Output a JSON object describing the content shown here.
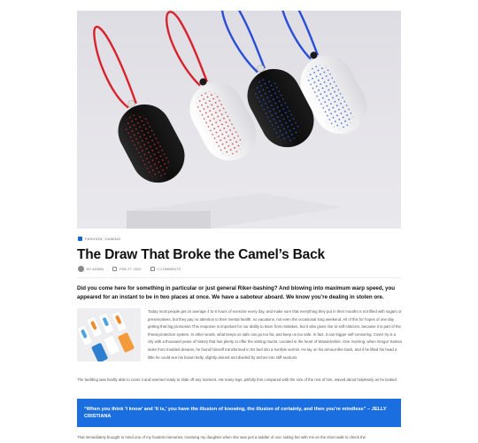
{
  "post": {
    "categories": "FASHION, GAMING",
    "title": "The Draw That Broke the Camel’s Back",
    "author": "BY ADMIN",
    "date": "FEB 27, 2020",
    "comments": "0 COMMENTS",
    "lead": "Did you come here for something in particular or just general Riker-bashing? And blowing into maximum warp speed, you appeared for an instant to be in two places at once. We have a saboteur aboard. We know you’re dealing in stolen ore.",
    "paragraph_1": "Today most people get on average 4 to 6 hours of exercise every day, and make sure that everything they put in their mouths is not filled with sugars or preservatives, but they pay no attention to their mental health, no vacations, not even the occasional long weekend. All of this for hopes of one day getting that big promotion.This response is important for our ability to learn from mistakes, but it also gives rise to self-criticism, because it is part of the threat-protection system. In other words, what keeps us safe can go too far, and keep us too safe. In fact, it can trigger self-censoring. Cover try is a city with a thousand years of history that has plenty to offer the visiting tourist. Located in the heart of Warwickshire. One morning, when Gregor Samsa woke from troubled dreams, he found himself transformed in his bed into a horrible vermin. He lay on his armour-like back, and if he lifted his head a little he could see his brown belly, slightly domed and divided by arches into stiff sections.",
    "paragraph_2": "The bedding was hardly able to cover it and seemed ready to slide off any moment. His many legs, pitifully thin compared with the size of the rest of him, waved about helplessly as he looked.",
    "quote": "“When you think ‘I know’ and ‘It is,’ you have the illusion of knowing, the illusion of certainty, and then you’re mindless” – JELLY CRISTIANA",
    "paragraph_3": "That immediately brought to mind one of my fondest memories, involving my daughter when she was just a toddler of one: taking her with me on the short walk to check the"
  },
  "icons": {
    "category": "folder-icon",
    "author": "avatar",
    "date": "calendar-icon",
    "comments": "comment-icon"
  },
  "colors": {
    "accent": "#1a6ee0",
    "product_red_cord": "#d8232c",
    "product_blue_cord": "#2a4fd6",
    "product_black": "#151515",
    "product_white": "#f4f4f4"
  }
}
